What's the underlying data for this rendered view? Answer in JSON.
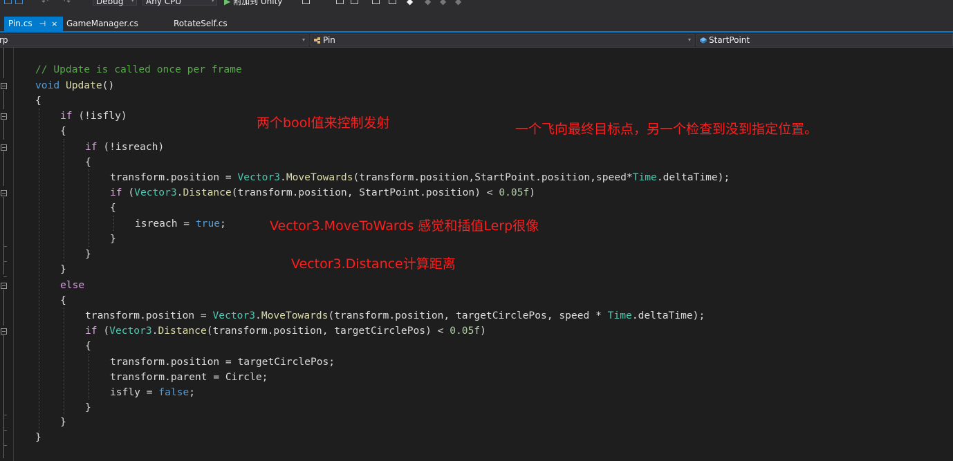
{
  "toolbar": {
    "config": "Debug",
    "platform": "Any CPU",
    "attach": "附加到 Unity"
  },
  "tabs": [
    {
      "label": "Pin.cs",
      "active": true
    },
    {
      "label": "GameManager.cs",
      "active": false
    },
    {
      "label": "RotateSelf.cs",
      "active": false
    }
  ],
  "navbar": {
    "project": "rp",
    "type": "Pin",
    "member": "StartPoint"
  },
  "code": {
    "l1": {
      "text": "// Update is called once per frame"
    },
    "l2": {
      "kw": "void",
      "name": "Update",
      "rest": "()"
    },
    "l3": "{",
    "l4": {
      "kw": "if",
      "rest": " (!isfly)"
    },
    "l5": "{",
    "l6": {
      "kw": "if",
      "rest": " (!isreach)"
    },
    "l7": "{",
    "l8": {
      "a": "transform.position = ",
      "t": "Vector3",
      "m": "MoveTowards",
      "b": "(transform.position,StartPoint.position,speed*",
      "t2": "Time",
      "c": ".deltaTime);"
    },
    "l9": {
      "kw": "if",
      "a": " (",
      "t": "Vector3",
      "m": "Distance",
      "b": "(transform.position, StartPoint.position) < ",
      "num": "0.05f",
      "c": ")"
    },
    "l10": "{",
    "l11": {
      "a": "isreach = ",
      "kw": "true",
      "c": ";"
    },
    "l12": "}",
    "l13": "}",
    "l14": "}",
    "l15": {
      "kw": "else"
    },
    "l16": "{",
    "l17": {
      "a": "transform.position = ",
      "t": "Vector3",
      "m": "MoveTowards",
      "b": "(transform.position, targetCirclePos, speed * ",
      "t2": "Time",
      "c": ".deltaTime);"
    },
    "l18": {
      "kw": "if",
      "a": " (",
      "t": "Vector3",
      "m": "Distance",
      "b": "(transform.position, targetCirclePos) < ",
      "num": "0.05f",
      "c": ")"
    },
    "l19": "{",
    "l20": "transform.position = targetCirclePos;",
    "l21": "transform.parent = Circle;",
    "l22": {
      "a": "isfly = ",
      "kw": "false",
      "c": ";"
    },
    "l23": "}",
    "l24": "}",
    "l25": "}"
  },
  "annotations": {
    "a1": "两个bool值来控制发射",
    "a2": "一个飞向最终目标点，另一个检查到没到指定位置。",
    "a3": "Vector3.MoveToWards 感觉和插值Lerp很像",
    "a4": "Vector3.Distance计算距离"
  },
  "colors": {
    "background": "#1e1e1e",
    "keyword": "#569cd6",
    "control": "#d8a0df",
    "type": "#4ec9b0",
    "method": "#dcdcaa",
    "number": "#b5cea8",
    "comment": "#57a64a",
    "annotation": "#ff1e1e",
    "accent": "#007acc"
  }
}
